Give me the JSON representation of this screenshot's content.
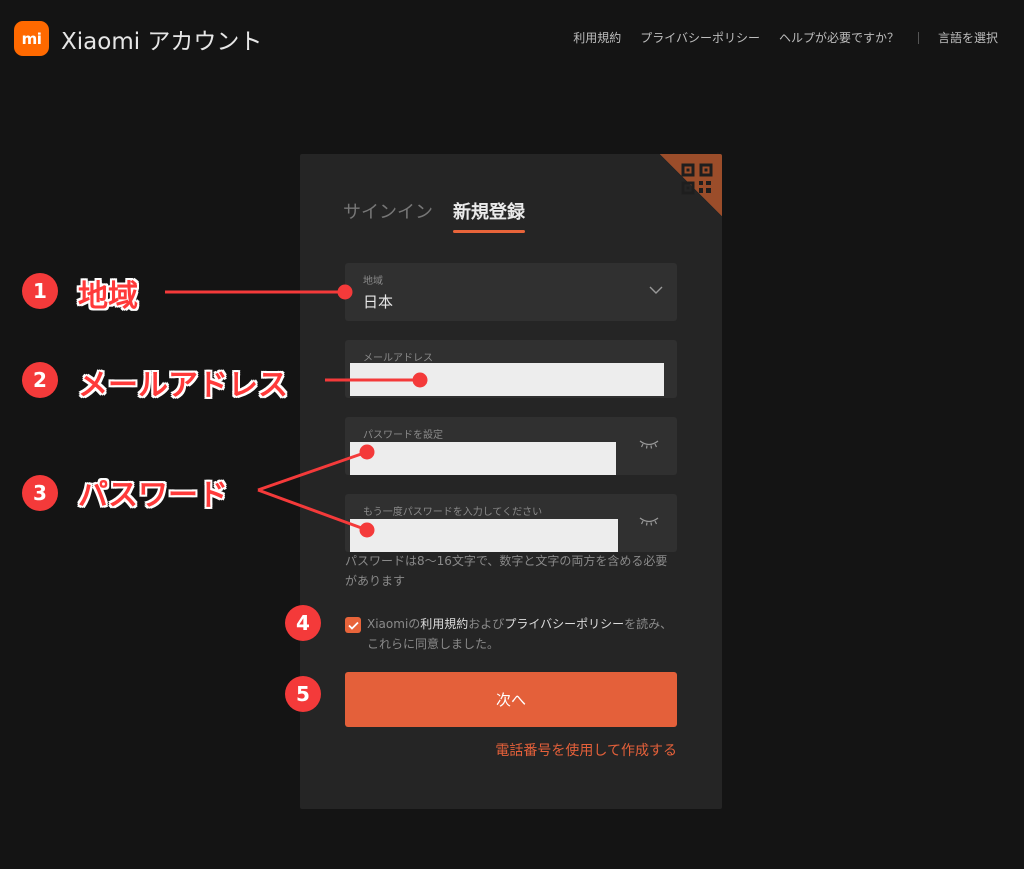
{
  "header": {
    "logo_text": "mi",
    "brand": "Xiaomi アカウント",
    "nav": [
      "利用規約",
      "プライバシーポリシー",
      "ヘルプが必要ですか？",
      "言語を選択"
    ]
  },
  "card": {
    "tabs": {
      "signin": "サインイン",
      "signup": "新規登録"
    },
    "region": {
      "label": "地域",
      "value": "日本"
    },
    "email": {
      "label": "メールアドレス"
    },
    "password": {
      "label": "パスワードを設定"
    },
    "password_confirm": {
      "label": "もう一度パスワードを入力してください"
    },
    "hint": "パスワードは8〜16文字で、数字と文字の両方を含める必要があります",
    "agree": {
      "prefix": "Xiaomiの",
      "terms": "利用規約",
      "middle": "および",
      "privacy": "プライバシーポリシー",
      "suffix": "を読み、これらに同意しました。",
      "checked": true
    },
    "next_button": "次へ",
    "phone_link": "電話番号を使用して作成する"
  },
  "annotations": [
    {
      "num": "1",
      "label": "地域"
    },
    {
      "num": "2",
      "label": "メールアドレス"
    },
    {
      "num": "3",
      "label": "パスワード"
    },
    {
      "num": "4",
      "label": ""
    },
    {
      "num": "5",
      "label": ""
    }
  ],
  "colors": {
    "accent": "#e4603a",
    "annotation": "#f43a3a",
    "background": "#141414",
    "card": "#252525"
  }
}
